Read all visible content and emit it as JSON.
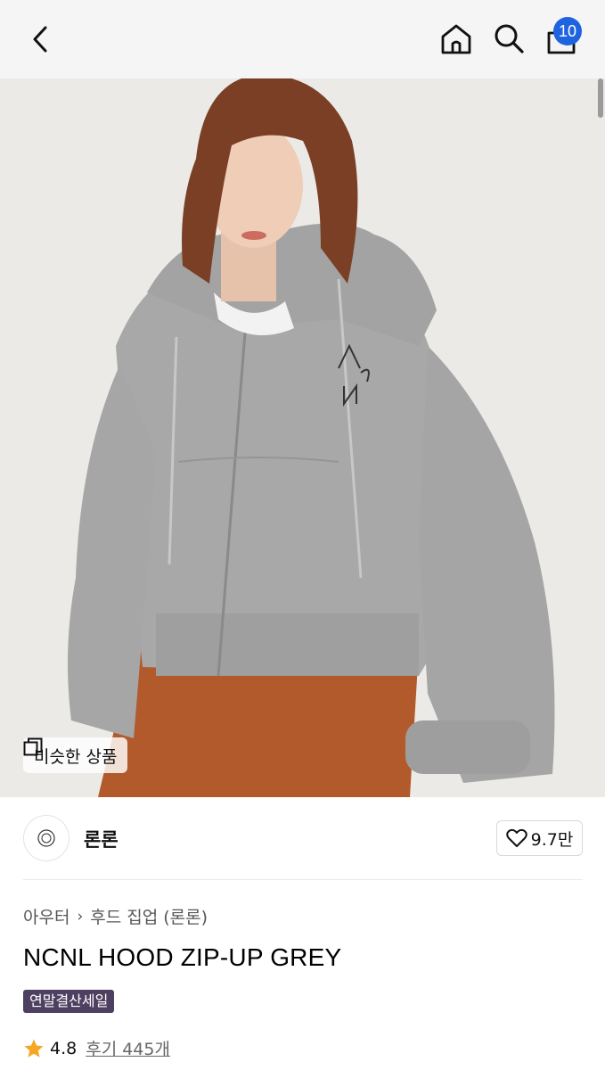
{
  "header": {
    "back_icon": "chevron-left-icon",
    "home_icon": "home-icon",
    "search_icon": "search-icon",
    "cart_icon": "shopping-bag-icon",
    "cart_count": "10",
    "badge_color": "#1e63e0"
  },
  "hero": {
    "similar_button_label": "비슷한 상품"
  },
  "brand": {
    "name": "론론",
    "likes": "9.7만"
  },
  "product": {
    "breadcrumb": [
      "아우터",
      "후드 집업 (론론)"
    ],
    "title": "NCNL HOOD ZIP-UP GREY",
    "badge": "연말결산세일",
    "badge_color": "#4d4060",
    "rating": "4.8",
    "reviews": "후기 445개",
    "star_color": "#f5a623"
  }
}
